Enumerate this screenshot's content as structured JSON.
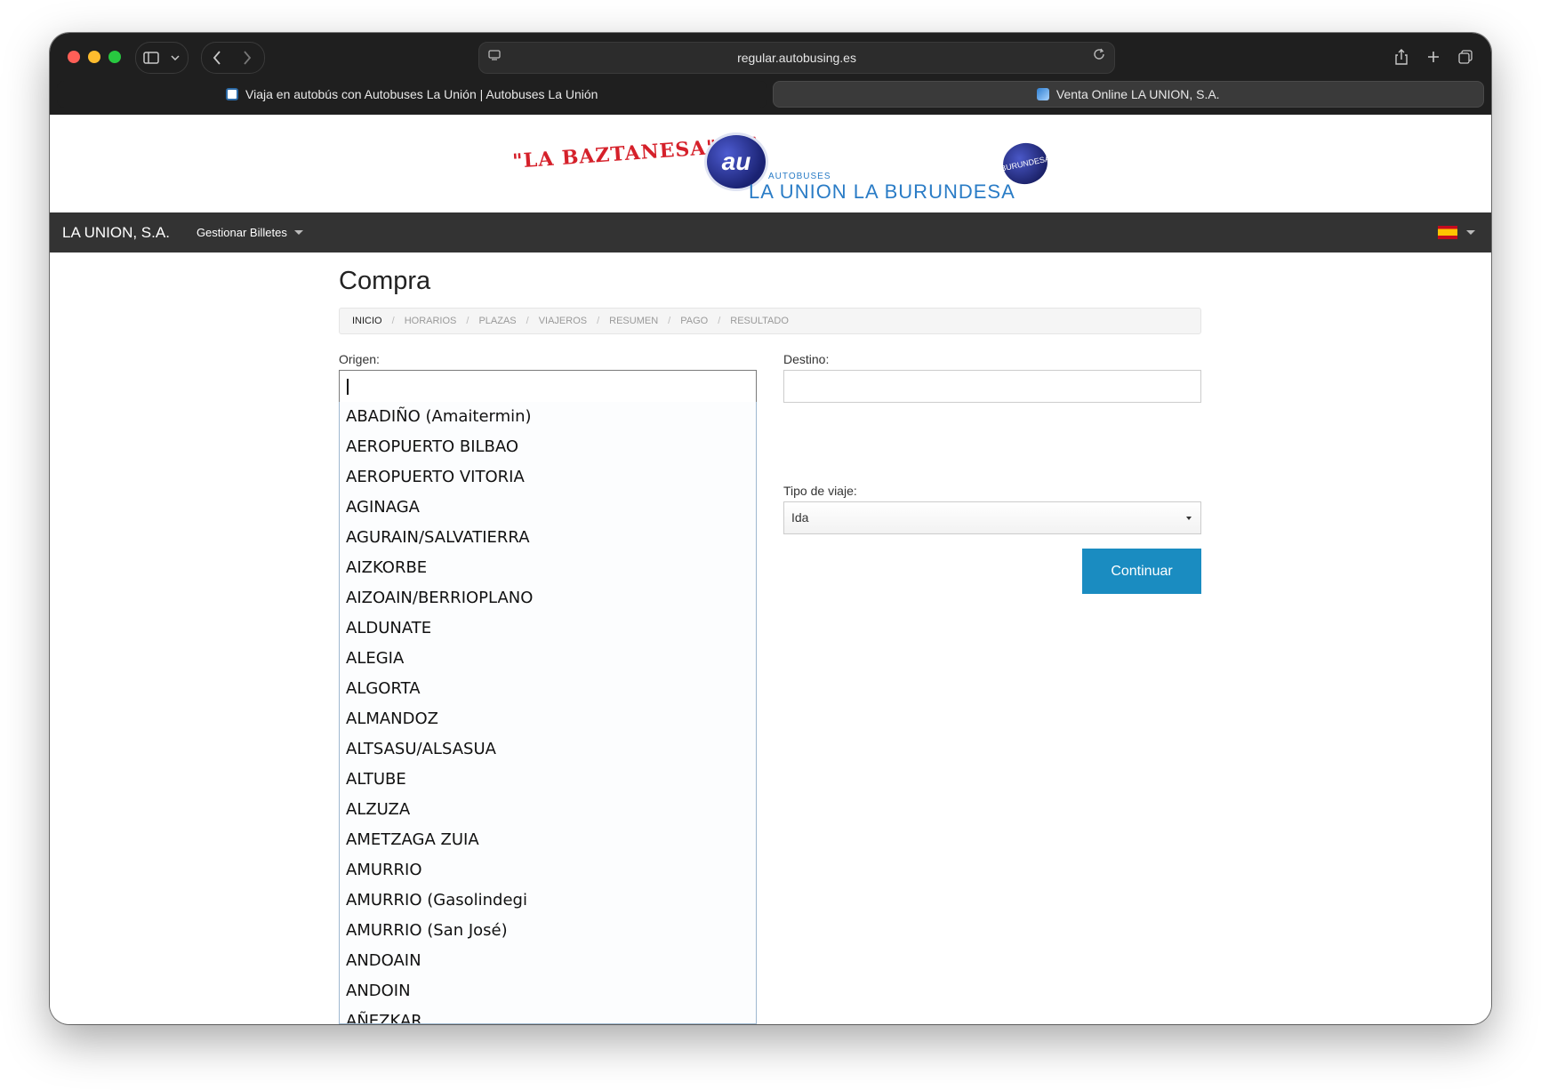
{
  "browser": {
    "url": "regular.autobusing.es",
    "tabs": [
      {
        "title": "Viaja en autobús con Autobuses La Unión | Autobuses La Unión",
        "active": false
      },
      {
        "title": "Venta Online LA UNION, S.A.",
        "active": true
      }
    ]
  },
  "header": {
    "logo_baztanesa": "\"LA BAZTANESA\" S.A",
    "logo_au": "au",
    "logo_small": "AUTOBUSES",
    "logo_main": "LA UNION LA BURUNDESA",
    "logo_burundesa": "BURUNDESA"
  },
  "navbar": {
    "brand": "LA UNION, S.A.",
    "menu_label": "Gestionar Billetes"
  },
  "page": {
    "title": "Compra",
    "breadcrumb": [
      "INICIO",
      "HORARIOS",
      "PLAZAS",
      "VIAJEROS",
      "RESUMEN",
      "PAGO",
      "RESULTADO"
    ],
    "current_step": "INICIO"
  },
  "form": {
    "origin_label": "Origen:",
    "origin_value": "",
    "destination_label": "Destino:",
    "destination_value": "",
    "trip_type_label": "Tipo de viaje:",
    "trip_type_value": "Ida",
    "continue_label": "Continuar"
  },
  "origin_options": [
    "ABADIÑO (Amaitermin)",
    "AEROPUERTO BILBAO",
    "AEROPUERTO VITORIA",
    "AGINAGA",
    "AGURAIN/SALVATIERRA",
    "AIZKORBE",
    "AIZOAIN/BERRIOPLANO",
    "ALDUNATE",
    "ALEGIA",
    "ALGORTA",
    "ALMANDOZ",
    "ALTSASU/ALSASUA",
    "ALTUBE",
    "ALZUZA",
    "AMETZAGA ZUIA",
    "AMURRIO",
    "AMURRIO (Gasolindegi",
    "AMURRIO (San José)",
    "ANDOAIN",
    "ANDOIN",
    "AÑEZKAR"
  ],
  "colors": {
    "navbar_bg": "#333333",
    "button_bg": "#1a8cc1",
    "logo_red": "#d5202a",
    "logo_blue": "#2a7cc6"
  }
}
